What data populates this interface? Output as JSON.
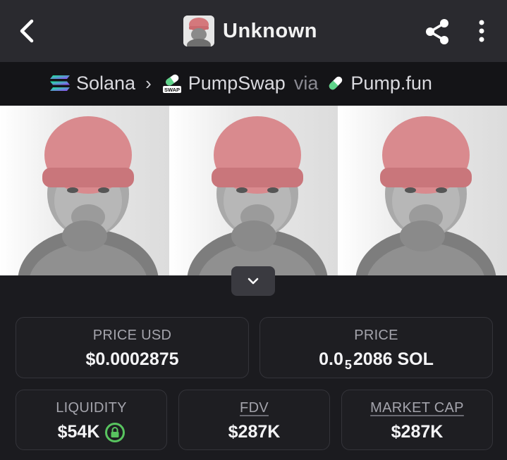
{
  "header": {
    "title": "Unknown",
    "back_icon": "chevron-left-icon",
    "share_icon": "share-icon",
    "more_icon": "vertical-dots-icon"
  },
  "breadcrumb": {
    "chain": "Solana",
    "dex": "PumpSwap",
    "dex_badge": "SWAP",
    "via": "via",
    "launchpad": "Pump.fun"
  },
  "stats": {
    "price_usd": {
      "label": "PRICE USD",
      "value": "$0.0002875"
    },
    "price": {
      "label": "PRICE",
      "value_prefix": "0.0",
      "value_subscript": "5",
      "value_suffix": "2086 SOL"
    },
    "liquidity": {
      "label": "LIQUIDITY",
      "value": "$54K"
    },
    "fdv": {
      "label": "FDV",
      "value": "$287K"
    },
    "market_cap": {
      "label": "MARKET CAP",
      "value": "$287K"
    }
  },
  "colors": {
    "background": "#1b1b1f",
    "topbar": "#2a2a2f",
    "card_border": "#34343a",
    "lock_green": "#58c45f",
    "solana_gradient": [
      "#14f195",
      "#9945ff"
    ],
    "pump_green": "#5fd38a"
  }
}
